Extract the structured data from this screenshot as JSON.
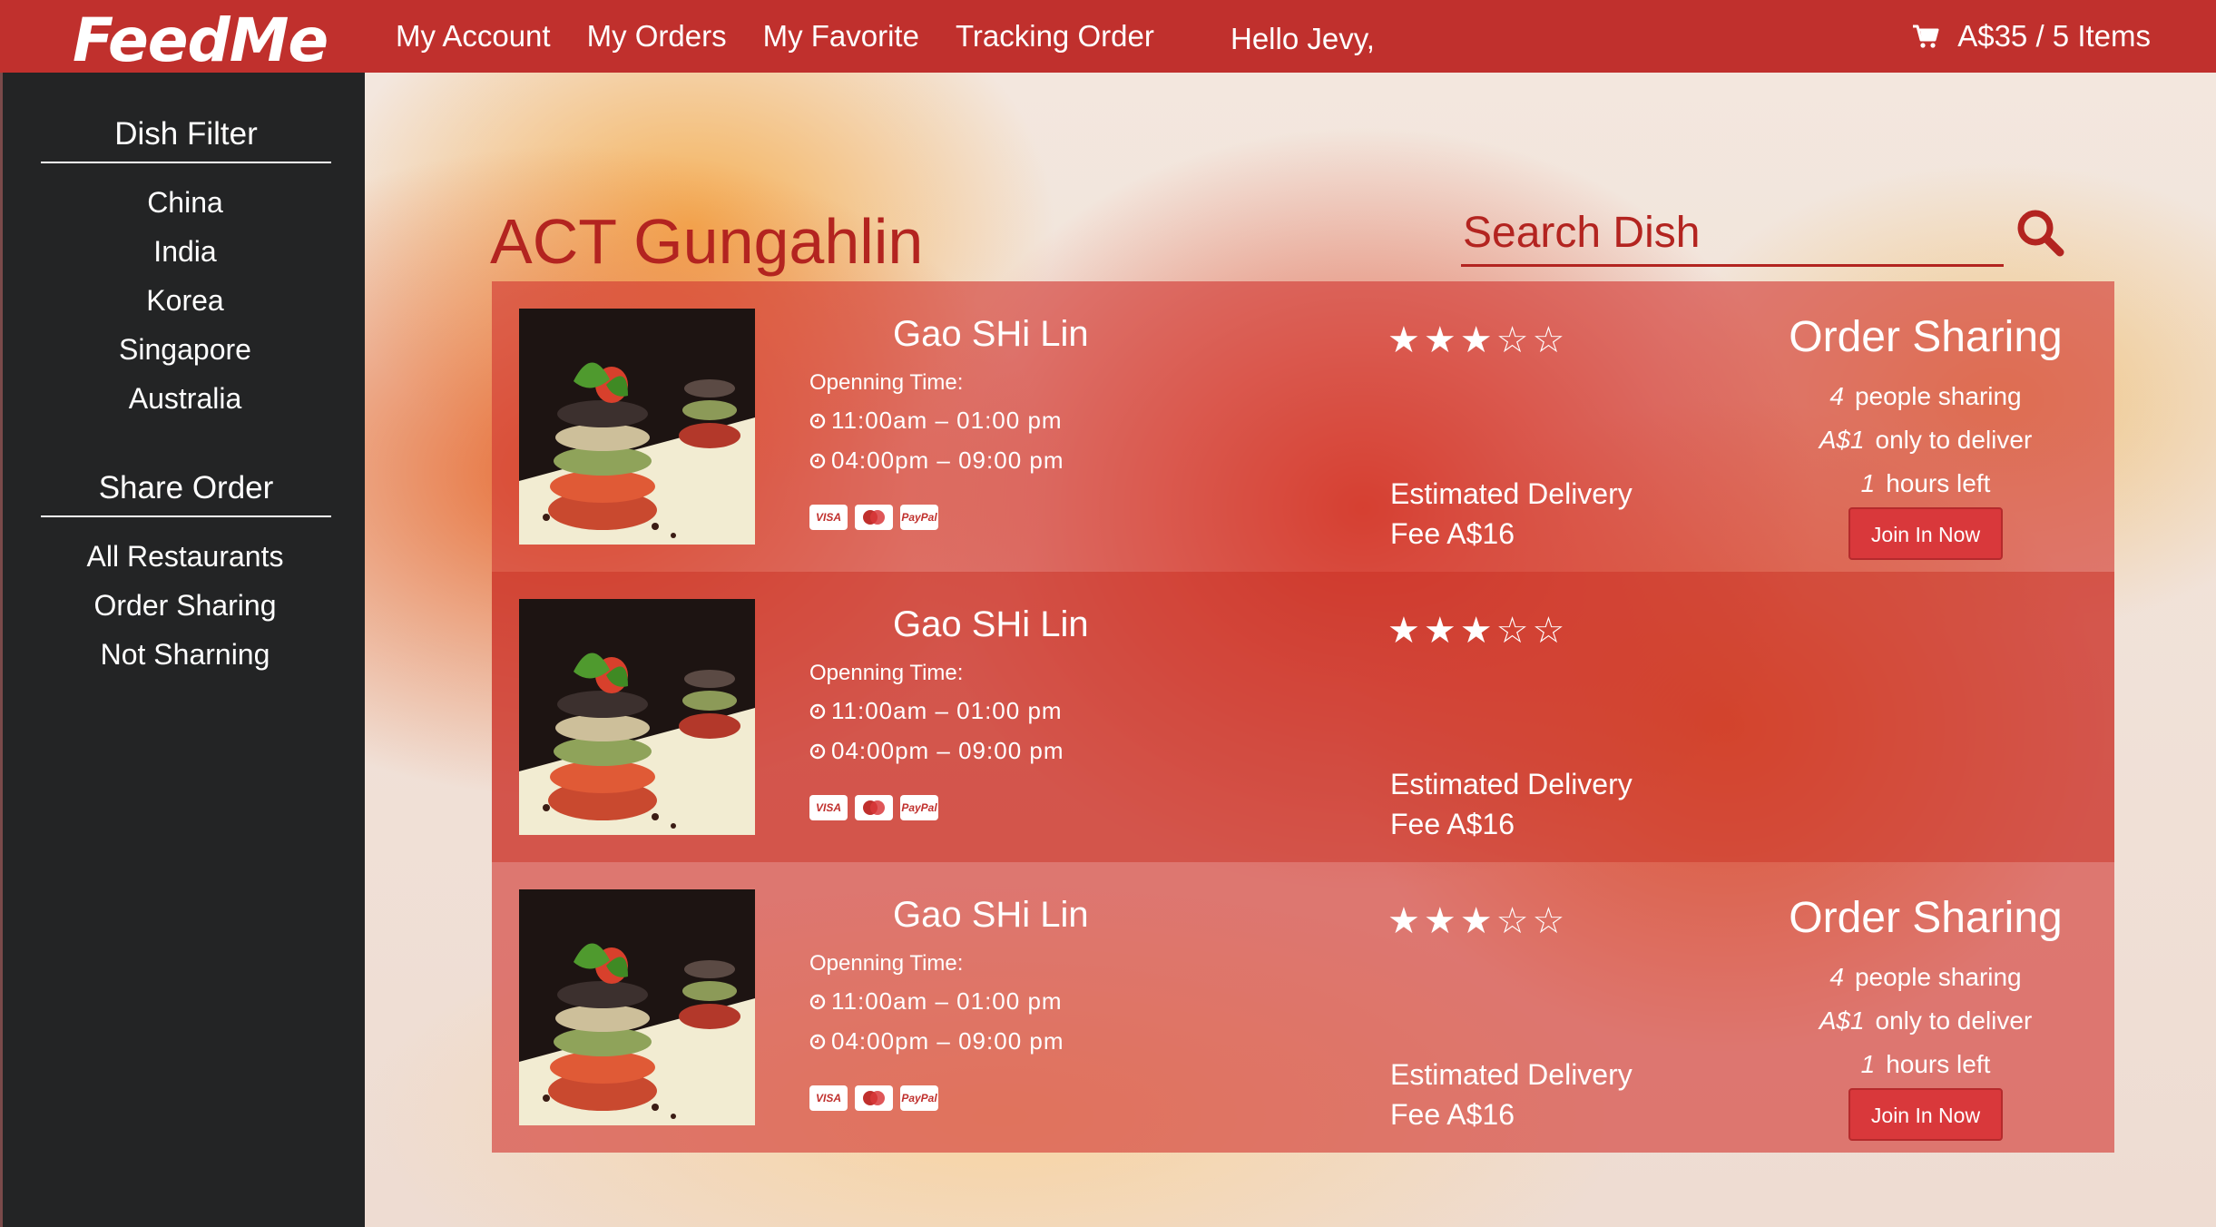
{
  "header": {
    "logo": "FeedMe",
    "nav": [
      "My Account",
      "My Orders",
      "My Favorite",
      "Tracking Order"
    ],
    "greeting": "Hello Jevy,",
    "cart": "A$35 / 5 Items"
  },
  "sidebar": {
    "dish_filter_title": "Dish Filter",
    "dish_filter_items": [
      "China",
      "India",
      "Korea",
      "Singapore",
      "Australia"
    ],
    "share_order_title": "Share Order",
    "share_order_items": [
      "All Restaurants",
      "Order Sharing",
      "Not Sharning"
    ]
  },
  "main": {
    "location": "ACT Gungahlin",
    "search_placeholder": "Search Dish",
    "restaurants": [
      {
        "name": "Gao SHi Lin",
        "opening_label": "Openning Time:",
        "times": [
          "11:00am – 01:00 pm",
          "04:00pm – 09:00 pm"
        ],
        "payments": [
          "VISA",
          "MC",
          "PayPal"
        ],
        "stars": "★★★☆☆",
        "rating": 3,
        "fee_line1": "Estimated Delivery",
        "fee_line2": "Fee A$16",
        "sharing": {
          "title": "Order Sharing",
          "people_value": "4",
          "people_text": "people sharing",
          "deliver_value": "A$1",
          "deliver_text": "only to deliver",
          "hours_value": "1",
          "hours_text": "hours left",
          "button": "Join In Now"
        }
      },
      {
        "name": "Gao SHi Lin",
        "opening_label": "Openning Time:",
        "times": [
          "11:00am – 01:00 pm",
          "04:00pm – 09:00 pm"
        ],
        "payments": [
          "VISA",
          "MC",
          "PayPal"
        ],
        "stars": "★★★☆☆",
        "rating": 3,
        "fee_line1": "Estimated Delivery",
        "fee_line2": "Fee A$16"
      },
      {
        "name": "Gao SHi Lin",
        "opening_label": "Openning Time:",
        "times": [
          "11:00am – 01:00 pm",
          "04:00pm – 09:00 pm"
        ],
        "payments": [
          "VISA",
          "MC",
          "PayPal"
        ],
        "stars": "★★★☆☆",
        "rating": 3,
        "fee_line1": "Estimated Delivery",
        "fee_line2": "Fee A$16",
        "sharing": {
          "title": "Order Sharing",
          "people_value": "4",
          "people_text": "people sharing",
          "deliver_value": "A$1",
          "deliver_text": "only to deliver",
          "hours_value": "1",
          "hours_text": "hours left",
          "button": "Join In Now"
        }
      }
    ]
  },
  "colors": {
    "brand": "#c0302d",
    "sidebar": "#232425",
    "accent_text": "#b32420"
  },
  "icons": {
    "cart": "cart-icon",
    "search": "search-icon",
    "clock": "clock-icon"
  }
}
